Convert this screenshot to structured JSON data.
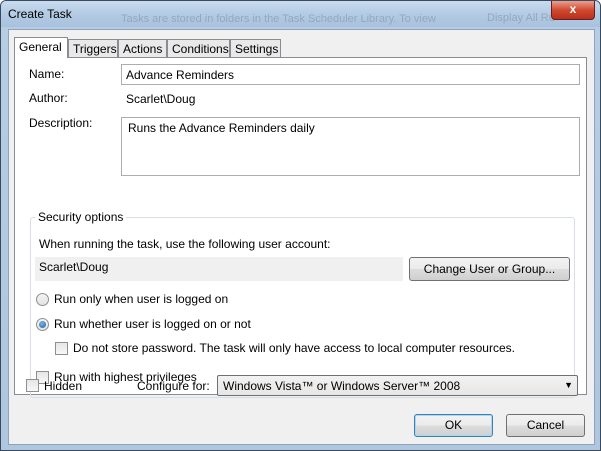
{
  "window": {
    "title": "Create Task",
    "close_glyph": "x",
    "background_ghost_text": "Tasks are stored in folders in the Task Scheduler Library. To view",
    "background_ghost_text2": "Display All Ru"
  },
  "tabs": [
    "General",
    "Triggers",
    "Actions",
    "Conditions",
    "Settings"
  ],
  "general": {
    "name_label": "Name:",
    "name_value": "Advance Reminders",
    "author_label": "Author:",
    "author_value": "Scarlet\\Doug",
    "description_label": "Description:",
    "description_value": "Runs the Advance Reminders daily"
  },
  "security": {
    "group_title": "Security options",
    "account_prompt": "When running the task, use the following user account:",
    "account_value": "Scarlet\\Doug",
    "change_user_button": "Change User or Group...",
    "radio_logged_on": "Run only when user is logged on",
    "radio_whether": "Run whether user is logged on or not",
    "radio_selected": "whether",
    "no_store_password": "Do not store password.  The task will only have access to local computer resources.",
    "no_store_password_checked": false,
    "highest_privileges": "Run with highest privileges",
    "highest_privileges_checked": false
  },
  "bottom": {
    "hidden_label": "Hidden",
    "hidden_checked": false,
    "configure_label": "Configure for:",
    "configure_value": "Windows Vista™ or Windows Server™ 2008"
  },
  "buttons": {
    "ok": "OK",
    "cancel": "Cancel"
  },
  "icons": {
    "dropdown": "chevron-down-icon",
    "close": "close-icon"
  },
  "colors": {
    "title_bar": "#b3cbe4",
    "close_button": "#d0492f",
    "default_button_border": "#3c7fb1"
  }
}
